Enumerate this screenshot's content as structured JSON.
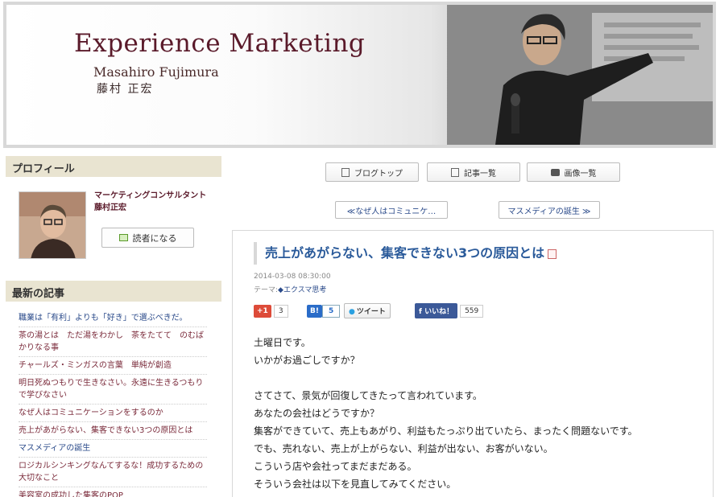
{
  "header": {
    "title": "Experience Marketing",
    "name_en": "Masahiro Fujimura",
    "name_jp": "藤村 正宏"
  },
  "sidebar": {
    "profile_heading": "プロフィール",
    "profile_name": "マーケティングコンサルタント藤村正宏",
    "reader_button": "読者になる",
    "latest_heading": "最新の記事",
    "latest_posts": [
      "職業は「有利」よりも「好き」で選ぶべきだ。",
      "茶の湯とは　ただ湯をわかし　茶をたてて　のむばかりなる事",
      "チャールズ・ミンガスの言葉　単純が創造",
      "明日死ぬつもりで生きなさい。永遠に生きるつもりで学びなさい",
      "なぜ人はコミュニケーションをするのか",
      "売上があがらない、集客できない3つの原因とは",
      "マスメディアの誕生",
      "ロジカルシンキングなんてするな！成功するための大切なこと",
      "美容室の成功した集客のPOP"
    ]
  },
  "nav": {
    "blog_top": "ブログトップ",
    "articles": "記事一覧",
    "images": "画像一覧",
    "prev": "≪なぜ人はコミュニケ…",
    "next": "マスメディアの誕生 ≫"
  },
  "article": {
    "title": "売上があがらない、集客できない3つの原因とは",
    "date": "2014-03-08 08:30:00",
    "theme_label": "テーマ:",
    "theme": "◆エクスマ思考",
    "social": {
      "gplus": "+1",
      "gplus_count": "3",
      "hatena": "B!",
      "hatena_count": "5",
      "tweet": "ツイート",
      "like": "いいね！",
      "like_count": "559"
    },
    "paragraphs": [
      "土曜日です。",
      "いかがお過ごしですか？",
      "",
      "さてさて、景気が回復してきたって言われています。",
      "あなたの会社はどうですか？",
      "集客ができていて、売上もあがり、利益もたっぷり出ていたら、まったく問題ないです。",
      "でも、売れない、売上が上がらない、利益が出ない、お客がいない。",
      "こういう店や会社ってまだまだある。",
      "そういう会社は以下を見直してみてください。"
    ]
  },
  "colors": {
    "accent": "#5a1a2a",
    "link": "#2a4a8a",
    "title": "#2a5a9a",
    "side_head_bg": "#e9e4d1"
  }
}
